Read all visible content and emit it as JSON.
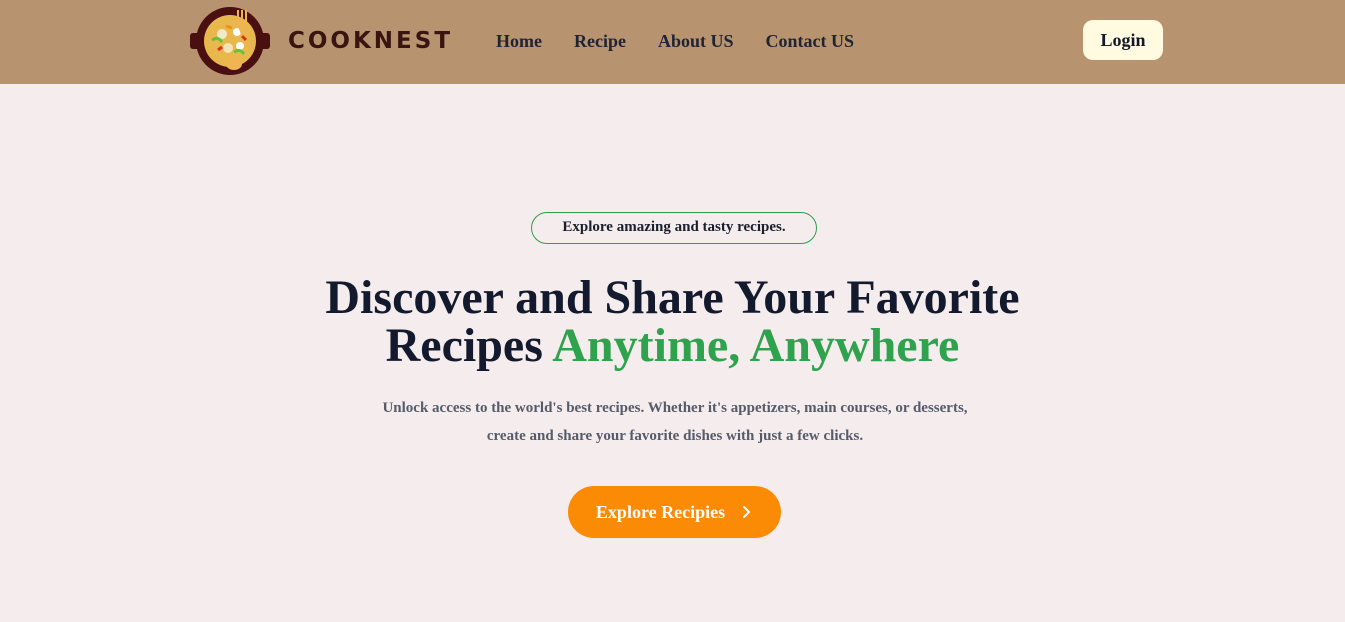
{
  "brand": {
    "name": "COOKNEST"
  },
  "nav": {
    "links": [
      {
        "label": "Home"
      },
      {
        "label": "Recipe"
      },
      {
        "label": "About US"
      },
      {
        "label": "Contact US"
      }
    ],
    "login_label": "Login"
  },
  "hero": {
    "tagline": "Explore amazing and tasty recipes.",
    "headline_main": "Discover and Share Your Favorite Recipes",
    "headline_accent": "Anytime, Anywhere",
    "description": "Unlock access to the world's best recipes. Whether it's appetizers, main courses, or desserts, create and share your favorite dishes with just a few clicks.",
    "cta_label": "Explore Recipies",
    "cta_icon": "chevron-right-icon"
  },
  "colors": {
    "navbar_bg": "#b89370",
    "page_bg": "#f5eced",
    "accent_green": "#2ea24c",
    "cta_orange": "#fb8a05",
    "login_bg": "#fffae0"
  }
}
